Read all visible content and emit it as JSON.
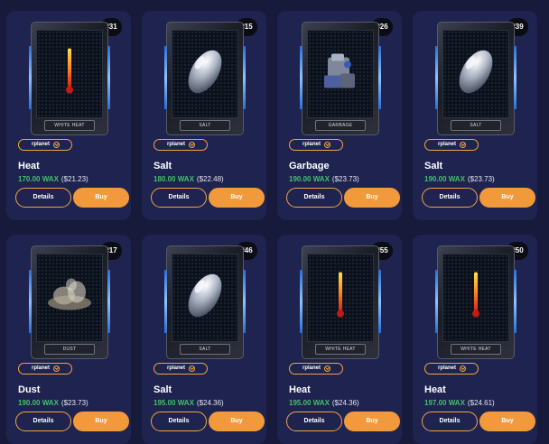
{
  "cards": [
    {
      "number": "#31",
      "art": "white-heat",
      "plate": "WHITE HEAT",
      "collection": "rplanet",
      "name": "Heat",
      "price_wax": "170.00 WAX",
      "price_usd": "($21.23)",
      "details_label": "Details",
      "buy_label": "Buy"
    },
    {
      "number": "#15",
      "art": "salt",
      "plate": "SALT",
      "collection": "rplanet",
      "name": "Salt",
      "price_wax": "180.00 WAX",
      "price_usd": "($22.48)",
      "details_label": "Details",
      "buy_label": "Buy"
    },
    {
      "number": "#26",
      "art": "garbage",
      "plate": "GARBAGE",
      "collection": "rplanet",
      "name": "Garbage",
      "price_wax": "190.00 WAX",
      "price_usd": "($23.73)",
      "details_label": "Details",
      "buy_label": "Buy"
    },
    {
      "number": "#39",
      "art": "salt",
      "plate": "SALT",
      "collection": "rplanet",
      "name": "Salt",
      "price_wax": "190.00 WAX",
      "price_usd": "($23.73)",
      "details_label": "Details",
      "buy_label": "Buy"
    },
    {
      "number": "#17",
      "art": "dust",
      "plate": "DUST",
      "collection": "rplanet",
      "name": "Dust",
      "price_wax": "190.00 WAX",
      "price_usd": "($23.73)",
      "details_label": "Details",
      "buy_label": "Buy"
    },
    {
      "number": "#46",
      "art": "salt",
      "plate": "SALT",
      "collection": "rplanet",
      "name": "Salt",
      "price_wax": "195.00 WAX",
      "price_usd": "($24.36)",
      "details_label": "Details",
      "buy_label": "Buy"
    },
    {
      "number": "#55",
      "art": "white-heat",
      "plate": "WHITE HEAT",
      "collection": "rplanet",
      "name": "Heat",
      "price_wax": "195.00 WAX",
      "price_usd": "($24.36)",
      "details_label": "Details",
      "buy_label": "Buy"
    },
    {
      "number": "#50",
      "art": "white-heat",
      "plate": "WHITE HEAT",
      "collection": "rplanet",
      "name": "Heat",
      "price_wax": "197.00 WAX",
      "price_usd": "($24.61)",
      "details_label": "Details",
      "buy_label": "Buy"
    }
  ],
  "colors": {
    "background": "#171a3a",
    "card": "#1f2350",
    "accent": "#f29a3b",
    "wax_price": "#42c06a"
  }
}
